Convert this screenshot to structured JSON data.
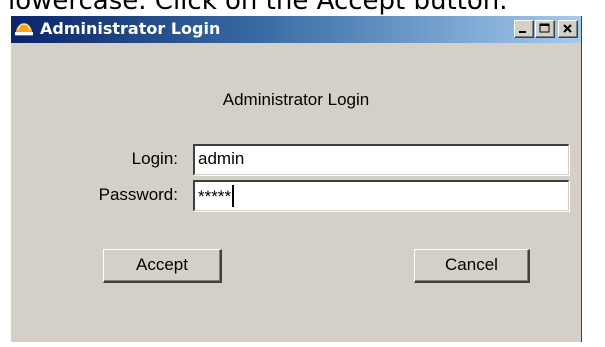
{
  "caption": "lowercase. Click on the Accept button.",
  "window": {
    "title": "Administrator Login",
    "controls": {
      "minimize": "minimize-icon",
      "maximize": "maximize-icon",
      "close": "close-icon"
    }
  },
  "form": {
    "heading": "Administrator Login",
    "login_label": "Login:",
    "login_value": "admin",
    "password_label": "Password:",
    "password_value": "*****"
  },
  "buttons": {
    "accept": "Accept",
    "cancel": "Cancel"
  },
  "colors": {
    "window_bg": "#d4d0c8",
    "title_start": "#0a246a",
    "title_end": "#a6caf0"
  }
}
